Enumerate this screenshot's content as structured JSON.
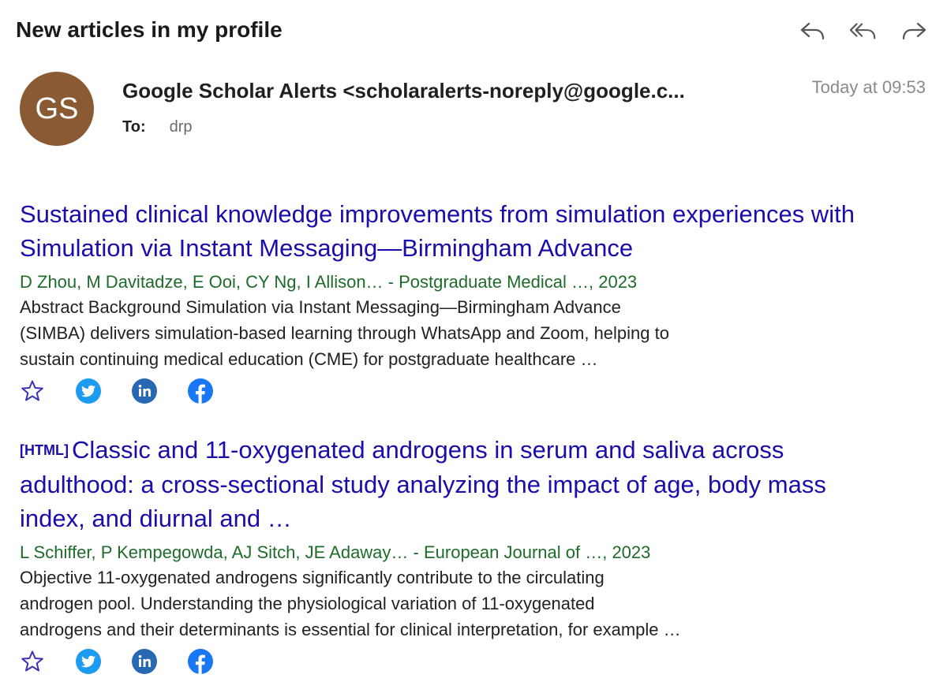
{
  "header": {
    "subject": "New articles in my profile",
    "actions": [
      {
        "name": "reply",
        "icon": "reply-icon"
      },
      {
        "name": "reply-all",
        "icon": "reply-all-icon"
      },
      {
        "name": "forward",
        "icon": "forward-icon"
      }
    ]
  },
  "message": {
    "avatar_initials": "GS",
    "avatar_color": "#8a5a33",
    "sender": "Google Scholar Alerts <scholaralerts-noreply@google.c...",
    "to_label": "To:",
    "to_value": "drp",
    "time": "Today at 09:53"
  },
  "articles": [
    {
      "tag": "",
      "title_lines": [
        "Sustained clinical knowledge improvements from simulation experiences with",
        "Simulation via Instant Messaging—Birmingham Advance"
      ],
      "authors": "D Zhou, M Davitadze, E Ooi, CY Ng, I Allison… - Postgraduate Medical …, 2023",
      "abstract_lines": [
        "Abstract Background Simulation via Instant Messaging—Birmingham Advance",
        "(SIMBA) delivers simulation-based learning through WhatsApp and Zoom, helping to",
        "sustain continuing medical education (CME) for postgraduate healthcare …"
      ]
    },
    {
      "tag": "[HTML]",
      "title_lines": [
        "Classic and 11-oxygenated androgens in serum and saliva across",
        "adulthood: a cross-sectional study analyzing the impact of age, body mass",
        "index, and diurnal and …"
      ],
      "authors": "L Schiffer, P Kempegowda, AJ Sitch, JE Adaway… - European Journal of …, 2023",
      "abstract_lines": [
        "Objective 11-oxygenated androgens significantly contribute to the circulating",
        "androgen pool. Understanding the physiological variation of 11-oxygenated",
        "androgens and their determinants is essential for clinical interpretation, for example …"
      ]
    }
  ],
  "share_icons": [
    "star-icon",
    "twitter-icon",
    "linkedin-icon",
    "facebook-icon"
  ],
  "colors": {
    "link": "#1a0dab",
    "authors": "#1e6b2a",
    "twitter": "#1d9bf0",
    "linkedin": "#2867b2",
    "facebook": "#1877f2"
  }
}
